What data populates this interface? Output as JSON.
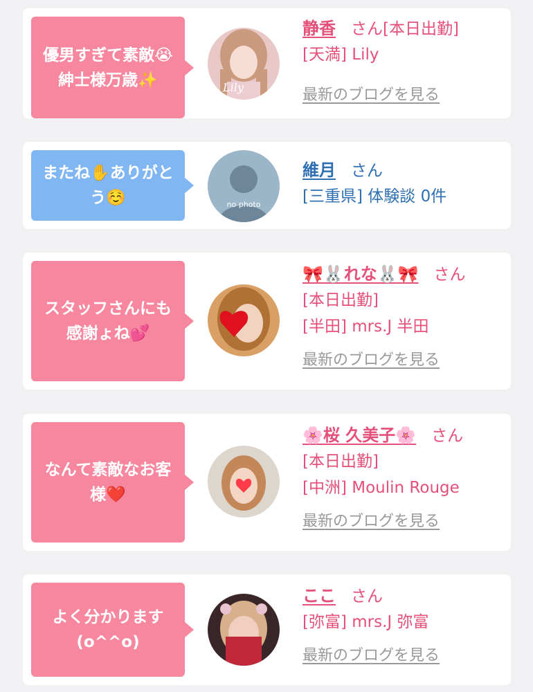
{
  "entries": [
    {
      "bubble": "優男すぎて素敵😭\n紳士様万歳✨",
      "bubble_color": "#f7879e",
      "name": "静香",
      "san": "さん[本日出勤]",
      "store": "[天満] Lily",
      "blog": "最新のブログを見る",
      "avatar_text": "Lily"
    },
    {
      "bubble": "またね✋ありがと\nう☺️",
      "bubble_color": "#80b6f1",
      "name": "維月",
      "san": "さん",
      "store": "[三重県] 体験談 0件",
      "avatar_text": "no photo"
    },
    {
      "bubble": "スタッフさんにも\n感謝ょね💕",
      "bubble_color": "#f7879e",
      "name": "🎀🐰れな🐰🎀",
      "san": "さん",
      "status": "[本日出勤]",
      "store": "[半田] mrs.J 半田",
      "blog": "最新のブログを見る"
    },
    {
      "bubble": "なんて素敵なお客\n様❤️",
      "bubble_color": "#f7879e",
      "name": "🌸桜 久美子🌸",
      "san": "さん",
      "status": "[本日出勤]",
      "store": "[中洲] Moulin Rouge",
      "blog": "最新のブログを見る"
    },
    {
      "bubble": "よく分かります\n(o^^o)",
      "bubble_color": "#f7879e",
      "name": "ここ",
      "san": "さん",
      "store": "[弥富] mrs.J 弥富",
      "blog": "最新のブログを見る"
    }
  ],
  "colors": {
    "name_pink": "#e5507a",
    "name_blue": "#2e6fb3",
    "blog_gray": "#999999",
    "card_bg": "#ffffff",
    "page_bg": "#f1f1f3"
  }
}
